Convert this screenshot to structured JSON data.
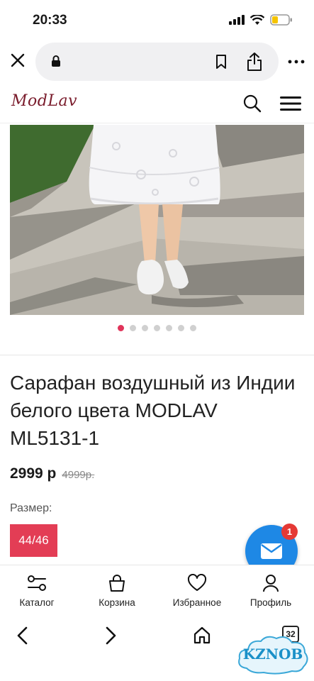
{
  "status": {
    "time": "20:33"
  },
  "browser": {
    "tab_count": "32"
  },
  "site": {
    "logo": "ModLav"
  },
  "product": {
    "title": "Сарафан воздушный из Индии белого цвета MODLAV ML5131-1",
    "price": "2999 р",
    "old_price": "4999р.",
    "size_label": "Размер:",
    "size_value": "44/46",
    "image_dots": 7,
    "active_dot": 0
  },
  "chat": {
    "badge": "1"
  },
  "bottom_nav": {
    "items": [
      {
        "label": "Каталог",
        "icon": "catalog-icon"
      },
      {
        "label": "Корзина",
        "icon": "bag-icon"
      },
      {
        "label": "Избранное",
        "icon": "heart-icon"
      },
      {
        "label": "Профиль",
        "icon": "profile-icon"
      }
    ]
  },
  "watermark": {
    "text": "KZNOB"
  },
  "colors": {
    "accent": "#e33d55",
    "chat": "#1e88e5",
    "badge": "#e53935",
    "dot_active": "#e0345a"
  }
}
